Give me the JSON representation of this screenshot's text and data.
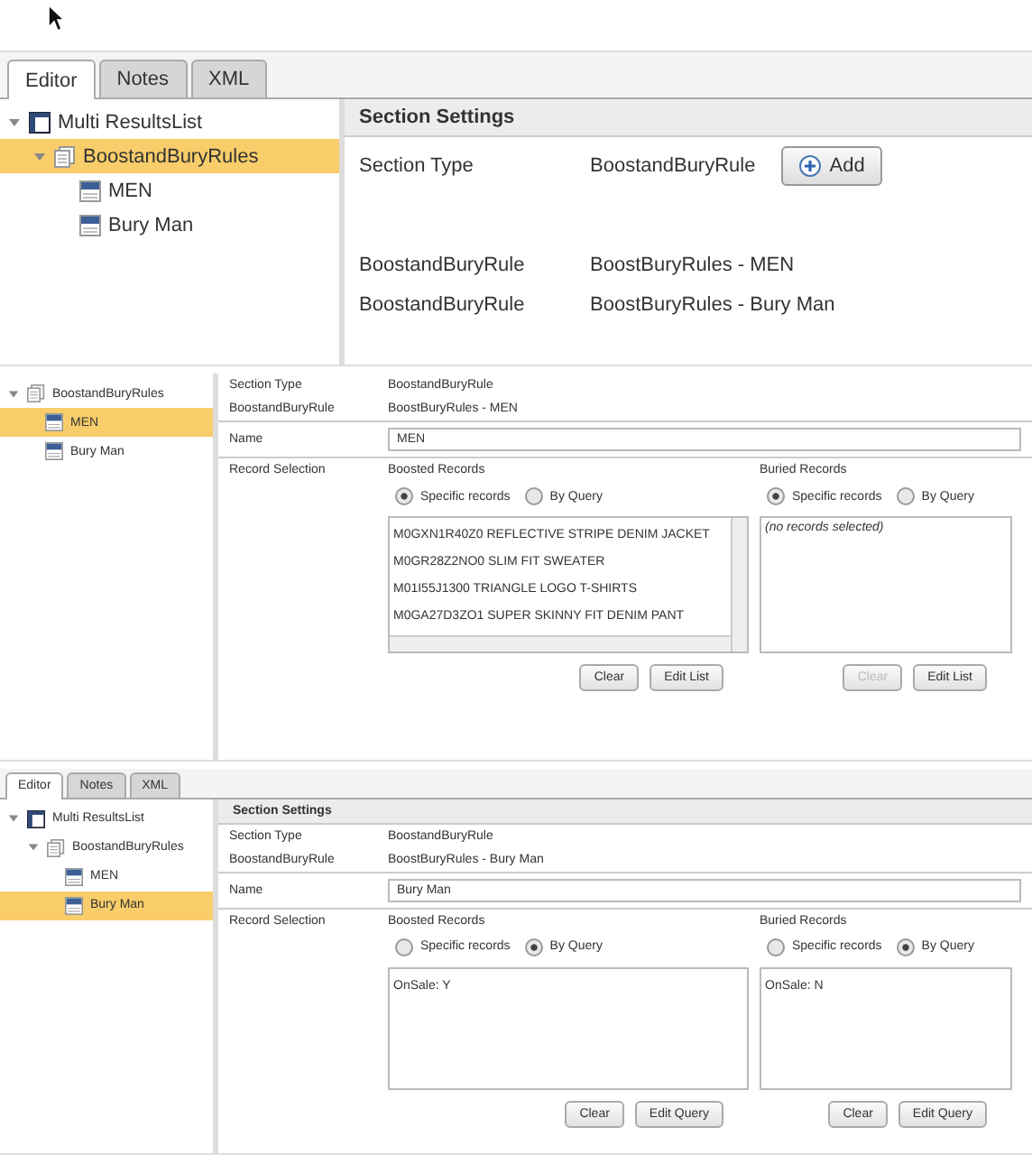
{
  "screens": [
    {
      "kind": "overview",
      "tabs": [
        {
          "label": "Editor",
          "selected": true
        },
        {
          "label": "Notes",
          "selected": false
        },
        {
          "label": "XML",
          "selected": false
        }
      ],
      "tree": [
        {
          "label": "Multi ResultsList",
          "kind": "list",
          "expanded": true,
          "selected": false,
          "children": [
            {
              "label": "BoostandBuryRules",
              "kind": "group",
              "expanded": true,
              "selected": true,
              "children": [
                {
                  "label": "MEN",
                  "kind": "rule",
                  "selected": false
                },
                {
                  "label": "Bury Man",
                  "kind": "rule",
                  "selected": false
                }
              ]
            }
          ]
        }
      ],
      "settings": {
        "title": "Section Settings",
        "fields": [
          {
            "label": "Section Type",
            "value": "BoostandBuryRule",
            "button": "Add"
          },
          {
            "label": "BoostandBuryRule",
            "value": "BoostBuryRules - MEN"
          },
          {
            "label": "BoostandBuryRule",
            "value": "BoostBuryRules - Bury Man"
          }
        ]
      }
    },
    {
      "kind": "detail",
      "tree": [
        {
          "label": "BoostandBuryRules",
          "kind": "group",
          "expanded": true,
          "selected": false,
          "children": [
            {
              "label": "MEN",
              "kind": "rule",
              "selected": true
            },
            {
              "label": "Bury Man",
              "kind": "rule",
              "selected": false
            }
          ]
        }
      ],
      "settings": {
        "fields": [
          {
            "label": "Section Type",
            "value": "BoostandBuryRule"
          },
          {
            "label": "BoostandBuryRule",
            "value": "BoostBuryRules - MEN"
          }
        ],
        "name": {
          "label": "Name",
          "value": "MEN"
        },
        "record_selection": {
          "label": "Record Selection",
          "groups": [
            {
              "title": "Boosted Records",
              "options": [
                {
                  "label": "Specific records",
                  "selected": true
                },
                {
                  "label": "By Query",
                  "selected": false
                }
              ],
              "items": [
                "M0GXN1R40Z0 REFLECTIVE STRIPE DENIM JACKET",
                "M0GR28Z2NO0 SLIM FIT SWEATER",
                "M01I55J1300 TRIANGLE LOGO T-SHIRTS",
                "M0GA27D3ZO1 SUPER SKINNY FIT DENIM PANT"
              ],
              "buttons": [
                {
                  "label": "Clear",
                  "disabled": false
                },
                {
                  "label": "Edit List",
                  "disabled": false
                }
              ]
            },
            {
              "title": "Buried Records",
              "options": [
                {
                  "label": "Specific records",
                  "selected": true
                },
                {
                  "label": "By Query",
                  "selected": false
                }
              ],
              "empty_text": "(no records selected)",
              "buttons": [
                {
                  "label": "Clear",
                  "disabled": true
                },
                {
                  "label": "Edit List",
                  "disabled": false
                }
              ]
            }
          ]
        }
      }
    },
    {
      "kind": "detail",
      "tabs": [
        {
          "label": "Editor",
          "selected": true
        },
        {
          "label": "Notes",
          "selected": false
        },
        {
          "label": "XML",
          "selected": false
        }
      ],
      "tree": [
        {
          "label": "Multi ResultsList",
          "kind": "list",
          "expanded": true,
          "selected": false,
          "children": [
            {
              "label": "BoostandBuryRules",
              "kind": "group",
              "expanded": true,
              "selected": false,
              "children": [
                {
                  "label": "MEN",
                  "kind": "rule",
                  "selected": false
                },
                {
                  "label": "Bury Man",
                  "kind": "rule",
                  "selected": true
                }
              ]
            }
          ]
        }
      ],
      "settings": {
        "title": "Section Settings",
        "fields": [
          {
            "label": "Section Type",
            "value": "BoostandBuryRule"
          },
          {
            "label": "BoostandBuryRule",
            "value": "BoostBuryRules - Bury Man"
          }
        ],
        "name": {
          "label": "Name",
          "value": "Bury Man"
        },
        "record_selection": {
          "label": "Record Selection",
          "groups": [
            {
              "title": "Boosted Records",
              "options": [
                {
                  "label": "Specific records",
                  "selected": false
                },
                {
                  "label": "By Query",
                  "selected": true
                }
              ],
              "items": [
                "OnSale: Y"
              ],
              "buttons": [
                {
                  "label": "Clear",
                  "disabled": false
                },
                {
                  "label": "Edit Query",
                  "disabled": false
                }
              ]
            },
            {
              "title": "Buried Records",
              "options": [
                {
                  "label": "Specific records",
                  "selected": false
                },
                {
                  "label": "By Query",
                  "selected": true
                }
              ],
              "items": [
                "OnSale: N"
              ],
              "buttons": [
                {
                  "label": "Clear",
                  "disabled": false
                },
                {
                  "label": "Edit Query",
                  "disabled": false
                }
              ]
            }
          ]
        }
      }
    }
  ]
}
